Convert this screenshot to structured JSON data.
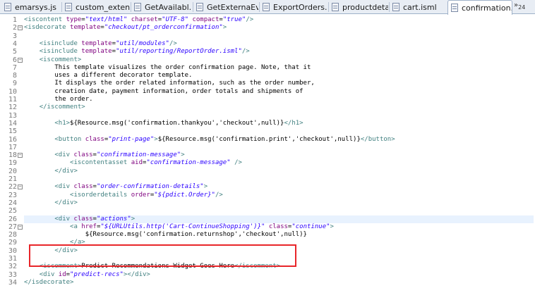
{
  "tabs": [
    {
      "label": "emarsys.js",
      "active": false
    },
    {
      "label": "custom_exten...",
      "active": false
    },
    {
      "label": "GetAvailabl...",
      "active": false
    },
    {
      "label": "GetExternaEv...",
      "active": false
    },
    {
      "label": "ExportOrders.ds",
      "active": false
    },
    {
      "label": "productdetai...",
      "active": false
    },
    {
      "label": "cart.isml",
      "active": false
    },
    {
      "label": "confirmation...",
      "active": true
    }
  ],
  "close_glyph": "×",
  "overflow": {
    "arrows": "»",
    "count": "24"
  },
  "current_line": 26,
  "highlight_lines": [
    32,
    33
  ],
  "highlight_color": "#e8262a",
  "lines": [
    {
      "n": 1,
      "indent": "",
      "fold": "",
      "tokens": [
        [
          "tag",
          "<iscontent "
        ],
        [
          "attr",
          "type"
        ],
        [
          "eq",
          "="
        ],
        [
          "val",
          "\"text/html\""
        ],
        [
          "txt",
          " "
        ],
        [
          "attr",
          "charset"
        ],
        [
          "eq",
          "="
        ],
        [
          "val",
          "\"UTF-8\""
        ],
        [
          "txt",
          " "
        ],
        [
          "attr",
          "compact"
        ],
        [
          "eq",
          "="
        ],
        [
          "val",
          "\"true\""
        ],
        [
          "tag",
          "/>"
        ]
      ]
    },
    {
      "n": 2,
      "indent": "",
      "fold": "minus",
      "tokens": [
        [
          "tag",
          "<isdecorate "
        ],
        [
          "attr",
          "template"
        ],
        [
          "eq",
          "="
        ],
        [
          "val",
          "\"checkout/pt_orderconfirmation\""
        ],
        [
          "tag",
          ">"
        ]
      ]
    },
    {
      "n": 3,
      "indent": "",
      "fold": "",
      "tokens": []
    },
    {
      "n": 4,
      "indent": "    ",
      "fold": "",
      "tokens": [
        [
          "tag",
          "<isinclude "
        ],
        [
          "attr",
          "template"
        ],
        [
          "eq",
          "="
        ],
        [
          "val",
          "\"util/modules\""
        ],
        [
          "tag",
          "/>"
        ]
      ]
    },
    {
      "n": 5,
      "indent": "    ",
      "fold": "",
      "tokens": [
        [
          "tag",
          "<isinclude "
        ],
        [
          "attr",
          "template"
        ],
        [
          "eq",
          "="
        ],
        [
          "val",
          "\"util/reporting/ReportOrder.isml\""
        ],
        [
          "tag",
          "/>"
        ]
      ]
    },
    {
      "n": 6,
      "indent": "    ",
      "fold": "minus",
      "tokens": [
        [
          "tag",
          "<iscomment>"
        ]
      ]
    },
    {
      "n": 7,
      "indent": "        ",
      "fold": "",
      "tokens": [
        [
          "txt",
          "This template visualizes the order confirmation page. Note, that it"
        ]
      ]
    },
    {
      "n": 8,
      "indent": "        ",
      "fold": "",
      "tokens": [
        [
          "txt",
          "uses a different decorator template."
        ]
      ]
    },
    {
      "n": 9,
      "indent": "        ",
      "fold": "",
      "tokens": [
        [
          "txt",
          "It displays the order related information, such as the order number,"
        ]
      ]
    },
    {
      "n": 10,
      "indent": "        ",
      "fold": "",
      "tokens": [
        [
          "txt",
          "creation date, payment information, order totals and shipments of"
        ]
      ]
    },
    {
      "n": 11,
      "indent": "        ",
      "fold": "",
      "tokens": [
        [
          "txt",
          "the order."
        ]
      ]
    },
    {
      "n": 12,
      "indent": "    ",
      "fold": "",
      "tokens": [
        [
          "tag",
          "</iscomment>"
        ]
      ]
    },
    {
      "n": 13,
      "indent": "",
      "fold": "",
      "tokens": []
    },
    {
      "n": 14,
      "indent": "        ",
      "fold": "",
      "tokens": [
        [
          "tag",
          "<h1>"
        ],
        [
          "txt",
          "${Resource.msg('confirmation.thankyou','checkout',null)}"
        ],
        [
          "tag",
          "</h1>"
        ]
      ]
    },
    {
      "n": 15,
      "indent": "",
      "fold": "",
      "tokens": []
    },
    {
      "n": 16,
      "indent": "        ",
      "fold": "",
      "tokens": [
        [
          "tag",
          "<button "
        ],
        [
          "attr",
          "class"
        ],
        [
          "eq",
          "="
        ],
        [
          "val",
          "\"print-page\""
        ],
        [
          "tag",
          ">"
        ],
        [
          "txt",
          "${Resource.msg('confirmation.print','checkout',null)}"
        ],
        [
          "tag",
          "</button>"
        ]
      ]
    },
    {
      "n": 17,
      "indent": "",
      "fold": "",
      "tokens": []
    },
    {
      "n": 18,
      "indent": "        ",
      "fold": "minus",
      "tokens": [
        [
          "tag",
          "<div "
        ],
        [
          "attr",
          "class"
        ],
        [
          "eq",
          "="
        ],
        [
          "val",
          "\"confirmation-message\""
        ],
        [
          "tag",
          ">"
        ]
      ]
    },
    {
      "n": 19,
      "indent": "            ",
      "fold": "",
      "tokens": [
        [
          "tag",
          "<iscontentasset "
        ],
        [
          "attr",
          "aid"
        ],
        [
          "eq",
          "="
        ],
        [
          "val",
          "\"confirmation-message\""
        ],
        [
          "txt",
          " "
        ],
        [
          "tag",
          "/>"
        ]
      ]
    },
    {
      "n": 20,
      "indent": "        ",
      "fold": "",
      "tokens": [
        [
          "tag",
          "</div>"
        ]
      ]
    },
    {
      "n": 21,
      "indent": "",
      "fold": "",
      "tokens": []
    },
    {
      "n": 22,
      "indent": "        ",
      "fold": "minus",
      "tokens": [
        [
          "tag",
          "<div "
        ],
        [
          "attr",
          "class"
        ],
        [
          "eq",
          "="
        ],
        [
          "val",
          "\"order-confirmation-details\""
        ],
        [
          "tag",
          ">"
        ]
      ]
    },
    {
      "n": 23,
      "indent": "            ",
      "fold": "",
      "tokens": [
        [
          "tag",
          "<isorderdetails "
        ],
        [
          "attr",
          "order"
        ],
        [
          "eq",
          "="
        ],
        [
          "val",
          "\"${pdict.Order}\""
        ],
        [
          "tag",
          "/>"
        ]
      ]
    },
    {
      "n": 24,
      "indent": "        ",
      "fold": "",
      "tokens": [
        [
          "tag",
          "</div>"
        ]
      ]
    },
    {
      "n": 25,
      "indent": "",
      "fold": "",
      "tokens": []
    },
    {
      "n": 26,
      "indent": "        ",
      "fold": "",
      "tokens": [
        [
          "tag",
          "<div "
        ],
        [
          "attr",
          "class"
        ],
        [
          "eq",
          "="
        ],
        [
          "val",
          "\"actions\""
        ],
        [
          "tag",
          ">"
        ]
      ]
    },
    {
      "n": 27,
      "indent": "            ",
      "fold": "minus",
      "tokens": [
        [
          "tag",
          "<a "
        ],
        [
          "attr",
          "href"
        ],
        [
          "eq",
          "="
        ],
        [
          "val",
          "\"${URLUtils.http('Cart-ContinueShopping')}\""
        ],
        [
          "txt",
          " "
        ],
        [
          "attr",
          "class"
        ],
        [
          "eq",
          "="
        ],
        [
          "val",
          "\"continue\""
        ],
        [
          "tag",
          ">"
        ]
      ]
    },
    {
      "n": 28,
      "indent": "                ",
      "fold": "",
      "tokens": [
        [
          "txt",
          "${Resource.msg('confirmation.returnshop','checkout',null)}"
        ]
      ]
    },
    {
      "n": 29,
      "indent": "            ",
      "fold": "",
      "tokens": [
        [
          "tag",
          "</a>"
        ]
      ]
    },
    {
      "n": 30,
      "indent": "        ",
      "fold": "",
      "tokens": [
        [
          "tag",
          "</div>"
        ]
      ]
    },
    {
      "n": 31,
      "indent": "",
      "fold": "",
      "tokens": []
    },
    {
      "n": 32,
      "indent": "    ",
      "fold": "",
      "tokens": [
        [
          "tag",
          "<iscomment>"
        ],
        [
          "txt",
          "Predict Recommendations Widget Goes Here"
        ],
        [
          "tag",
          "</iscomment>"
        ]
      ]
    },
    {
      "n": 33,
      "indent": "    ",
      "fold": "",
      "tokens": [
        [
          "tag",
          "<div "
        ],
        [
          "attr",
          "id"
        ],
        [
          "eq",
          "="
        ],
        [
          "val",
          "\"predict-recs\""
        ],
        [
          "tag",
          "></div>"
        ]
      ]
    },
    {
      "n": 34,
      "indent": "",
      "fold": "",
      "tokens": [
        [
          "tag",
          "</isdecorate>"
        ]
      ]
    }
  ]
}
